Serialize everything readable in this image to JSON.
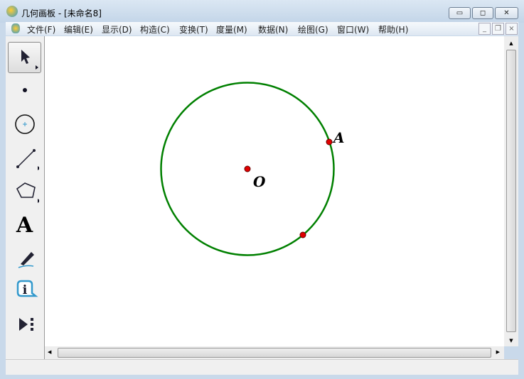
{
  "window": {
    "title": "几何画板 - [未命名8]",
    "minimize": "▭",
    "maximize": "◻",
    "close": "✕"
  },
  "menu": [
    "文件(F)",
    "编辑(E)",
    "显示(D)",
    "构造(C)",
    "变换(T)",
    "度量(M)",
    "数据(N)",
    "绘图(G)",
    "窗口(W)",
    "帮助(H)"
  ],
  "mdi": {
    "minimize": "_",
    "restore": "❐",
    "close": "×"
  },
  "tools": [
    "arrow-tool",
    "point-tool",
    "compass-tool",
    "straightedge-tool",
    "polygon-tool",
    "text-tool",
    "marker-tool",
    "information-tool",
    "custom-tool"
  ],
  "text_tool_label": "A",
  "canvas": {
    "labels": {
      "center": "O",
      "point": "A"
    },
    "circle_color": "#008000",
    "point_color": "#e00000"
  },
  "scroll": {
    "up": "▲",
    "down": "▼",
    "left": "◀",
    "right": "▶"
  }
}
